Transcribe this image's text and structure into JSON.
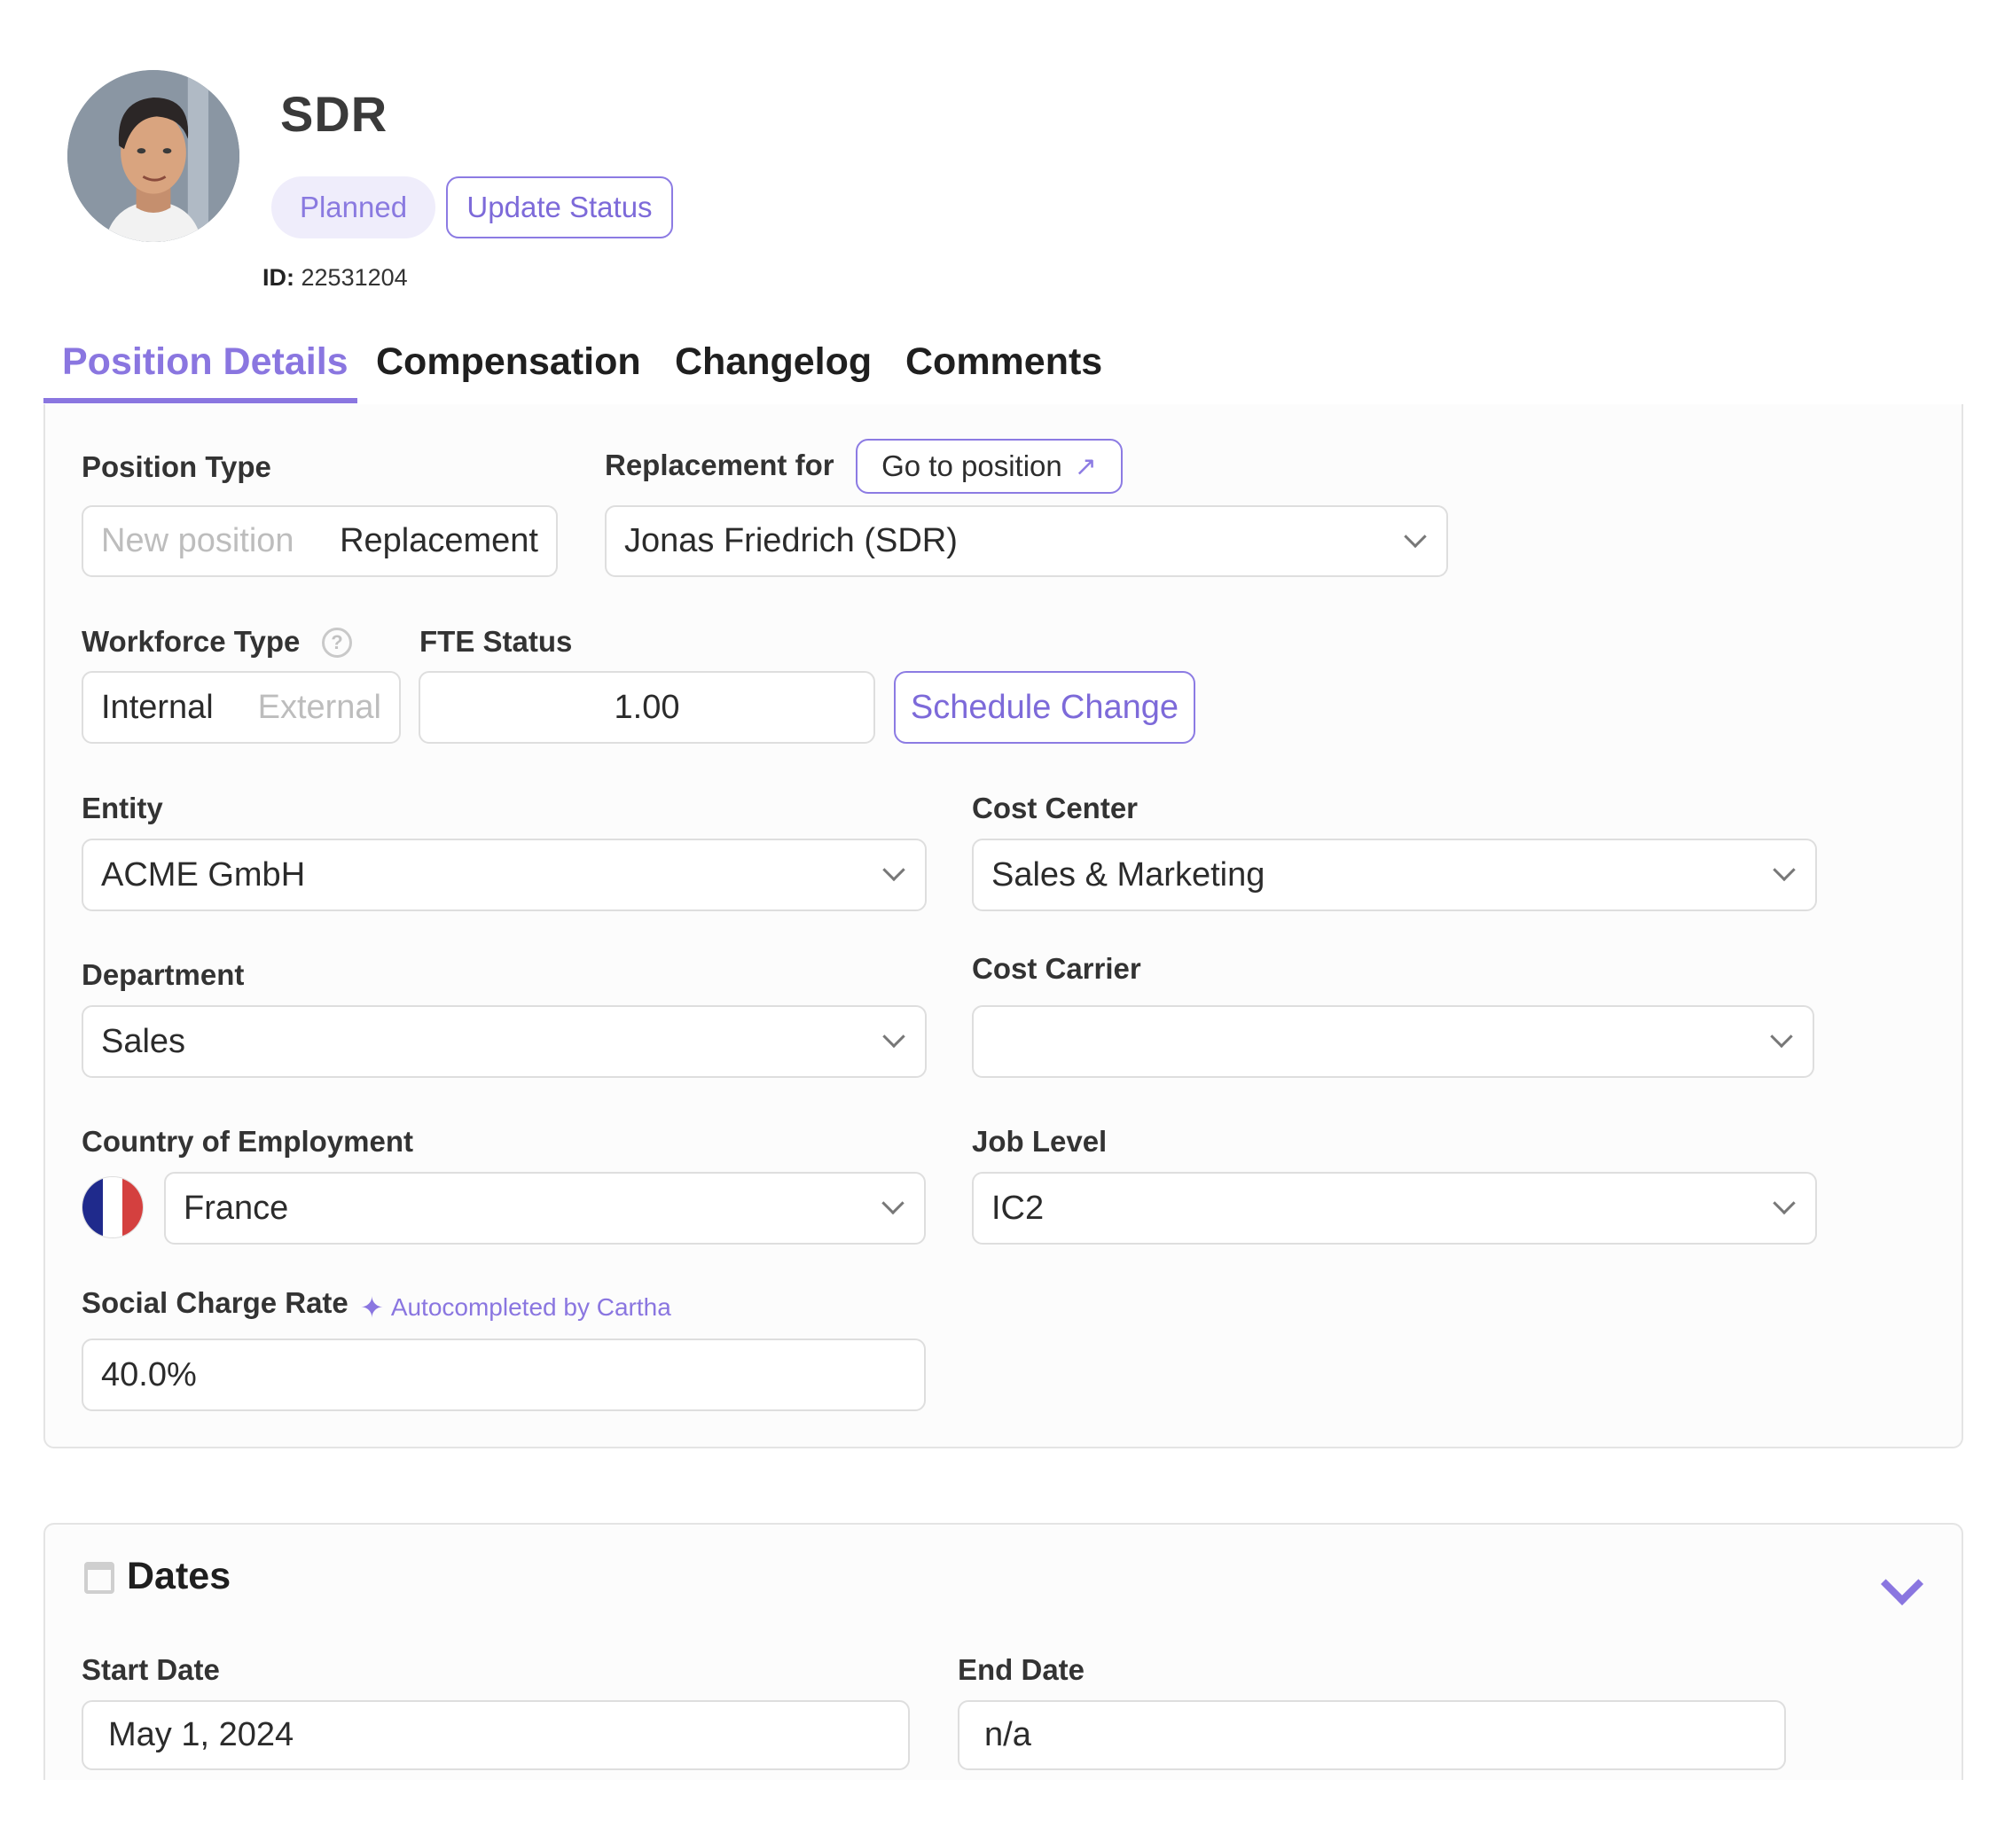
{
  "header": {
    "title": "SDR",
    "status": "Planned",
    "update_status_label": "Update Status",
    "id_label": "ID:",
    "id_value": "22531204"
  },
  "tabs": [
    {
      "label": "Position Details",
      "active": true
    },
    {
      "label": "Compensation",
      "active": false
    },
    {
      "label": "Changelog",
      "active": false
    },
    {
      "label": "Comments",
      "active": false
    }
  ],
  "position_details": {
    "position_type": {
      "label": "Position Type",
      "options": [
        "New position",
        "Replacement"
      ],
      "selected": "Replacement"
    },
    "replacement_for": {
      "label": "Replacement for",
      "go_to_label": "Go to position",
      "go_to_icon": "arrow-up-right-icon",
      "value": "Jonas Friedrich (SDR)"
    },
    "workforce_type": {
      "label": "Workforce Type",
      "help_icon": "?",
      "options": [
        "Internal",
        "External"
      ],
      "selected": "Internal"
    },
    "fte_status": {
      "label": "FTE Status",
      "value": "1.00",
      "schedule_change_label": "Schedule Change"
    },
    "entity": {
      "label": "Entity",
      "value": "ACME GmbH"
    },
    "cost_center": {
      "label": "Cost Center",
      "value": "Sales & Marketing"
    },
    "department": {
      "label": "Department",
      "value": "Sales"
    },
    "cost_carrier": {
      "label": "Cost Carrier",
      "value": ""
    },
    "country": {
      "label": "Country of Employment",
      "value": "France",
      "flag_colors": [
        "#1f2a8c",
        "#ffffff",
        "#d4403f"
      ]
    },
    "job_level": {
      "label": "Job Level",
      "value": "IC2"
    },
    "social_charge_rate": {
      "label": "Social Charge Rate",
      "autocomplete_note": "Autocompleted by Cartha",
      "autocomplete_icon": "✦",
      "value": "40.0%"
    }
  },
  "dates": {
    "title": "Dates",
    "start_date": {
      "label": "Start Date",
      "value": "May 1, 2024"
    },
    "end_date": {
      "label": "End Date",
      "value": "n/a"
    }
  },
  "colors": {
    "accent": "#8a76e0",
    "pill_bg": "#efedfb",
    "border": "#dedede"
  }
}
